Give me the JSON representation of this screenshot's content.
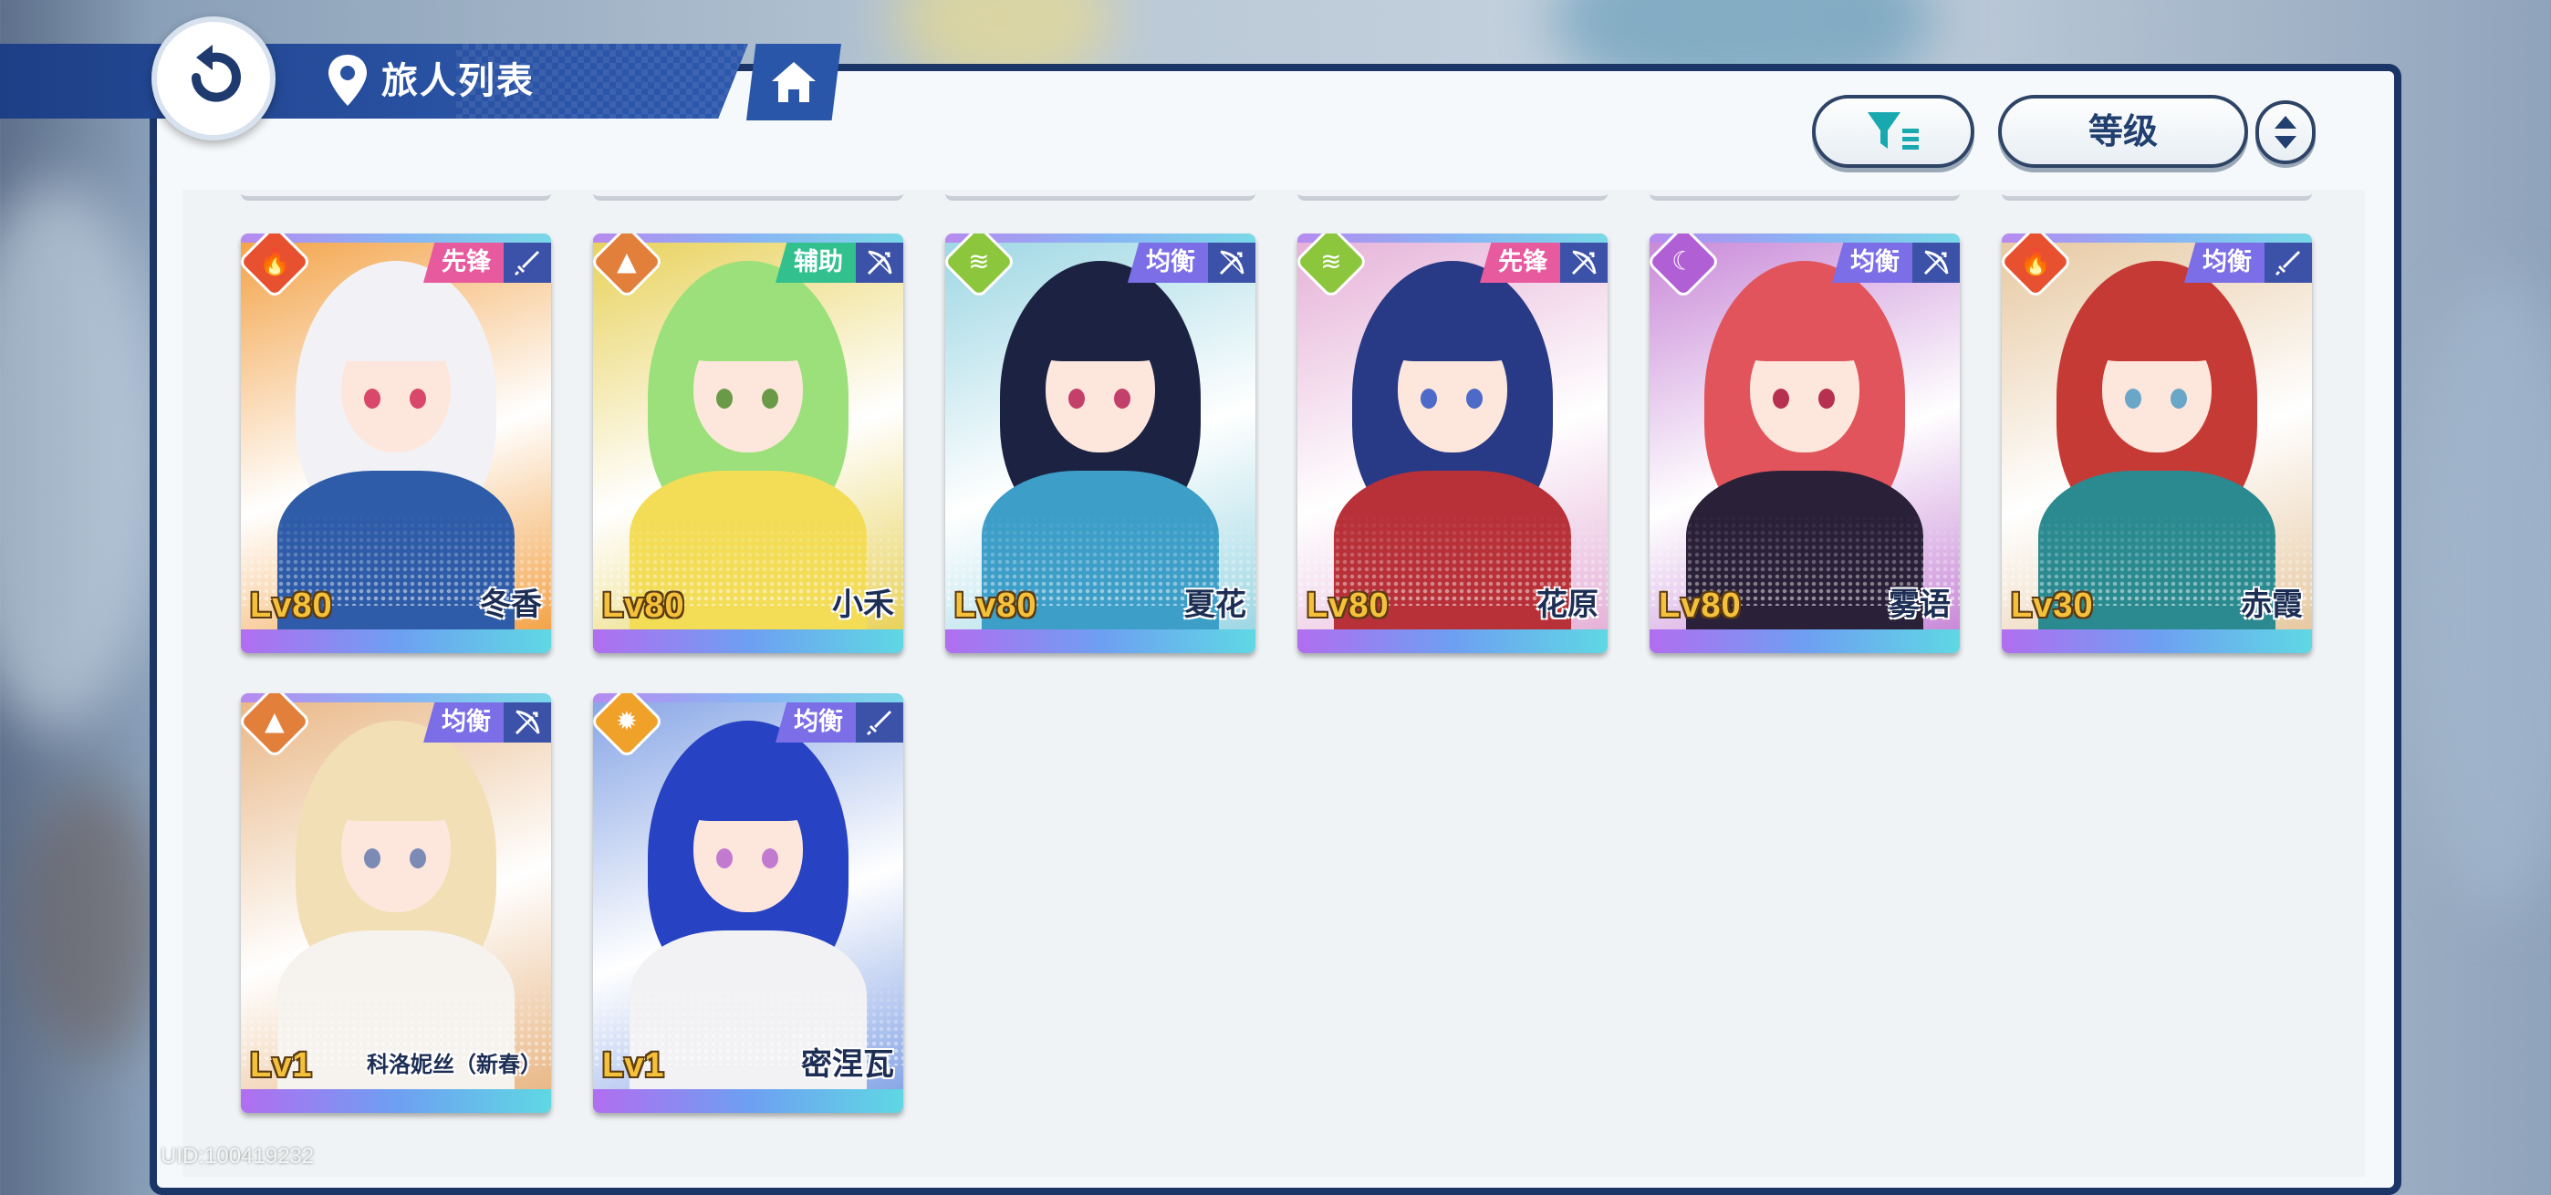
{
  "header": {
    "title": "旅人列表"
  },
  "toolbar": {
    "sort_label": "等级"
  },
  "uid_text": "UID:100419232",
  "roles": {
    "vanguard": "先锋",
    "support": "辅助",
    "balance": "均衡"
  },
  "characters": [
    {
      "name": "冬香",
      "level": "Lv80",
      "role": "先锋",
      "element": "fire",
      "weapon": "sword",
      "role_color": "#e85a9e",
      "hair": "#f2f2f6",
      "eye": "#d9476a",
      "outfit": "#2f5ca8",
      "bg": "#f3a44a"
    },
    {
      "name": "小禾",
      "level": "Lv80",
      "role": "辅助",
      "element": "earth",
      "weapon": "bow",
      "role_color": "#33c08f",
      "hair": "#9be07a",
      "eye": "#6a9a48",
      "outfit": "#f3dc56",
      "bg": "#e8d25c"
    },
    {
      "name": "夏花",
      "level": "Lv80",
      "role": "均衡",
      "element": "wind",
      "weapon": "bow",
      "role_color": "#7b6ee6",
      "hair": "#1c2342",
      "eye": "#c3406a",
      "outfit": "#3d9ec8",
      "bg": "#9ed7e4"
    },
    {
      "name": "花原",
      "level": "Lv80",
      "role": "先锋",
      "element": "wind",
      "weapon": "bow",
      "role_color": "#e85a9e",
      "hair": "#283a85",
      "eye": "#4d6ac8",
      "outfit": "#b83139",
      "bg": "#e6b2d8"
    },
    {
      "name": "雾语",
      "level": "Lv80",
      "role": "均衡",
      "element": "moon",
      "weapon": "bow",
      "role_color": "#7b6ee6",
      "hair": "#e2545b",
      "eye": "#b63050",
      "outfit": "#2a2038",
      "bg": "#c98ad8"
    },
    {
      "name": "赤霞",
      "level": "Lv30",
      "role": "均衡",
      "element": "fire",
      "weapon": "sword",
      "role_color": "#7b6ee6",
      "hair": "#c63a36",
      "eye": "#6aa6c8",
      "outfit": "#2a8a90",
      "bg": "#e7c9a2"
    },
    {
      "name": "科洛妮丝（新春）",
      "level": "Lv1",
      "role": "均衡",
      "element": "earth",
      "weapon": "bow",
      "role_color": "#7b6ee6",
      "hair": "#f2dfb6",
      "eye": "#7b8bb5",
      "outfit": "#f6f3ee",
      "bg": "#e9b887"
    },
    {
      "name": "密涅瓦",
      "level": "Lv1",
      "role": "均衡",
      "element": "light",
      "weapon": "sword",
      "role_color": "#7b6ee6",
      "hair": "#2742c2",
      "eye": "#c27ad0",
      "outfit": "#f2f2f4",
      "bg": "#89a7e6"
    }
  ],
  "icons": {
    "back": "back-arrow-icon",
    "location": "location-pin-icon",
    "home": "home-icon",
    "filter": "filter-icon",
    "order": "sort-order-icon"
  },
  "colors": {
    "accent": "#1e3f86",
    "panel": "#f6f9fb",
    "level": "#f5c13a",
    "name": "#1d2e55"
  }
}
